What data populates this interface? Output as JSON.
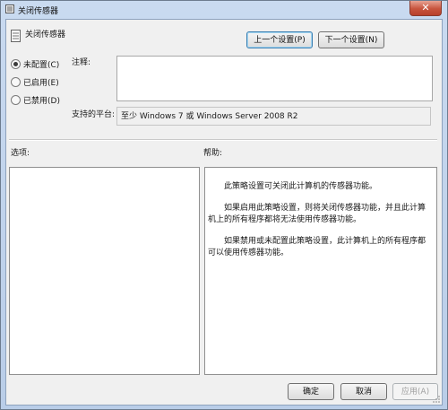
{
  "window": {
    "title": "关闭传感器",
    "close_label": "✕"
  },
  "header": {
    "setting_name": "关闭传感器",
    "prev_button": "上一个设置(P)",
    "next_button": "下一个设置(N)"
  },
  "state": {
    "options": [
      {
        "label": "未配置(C)",
        "checked": true
      },
      {
        "label": "已启用(E)",
        "checked": false
      },
      {
        "label": "已禁用(D)",
        "checked": false
      }
    ]
  },
  "comment": {
    "label": "注释:",
    "value": ""
  },
  "platform": {
    "label": "支持的平台:",
    "value": "至少 Windows 7 或 Windows Server 2008 R2"
  },
  "sections": {
    "options_label": "选项:",
    "help_label": "帮助:"
  },
  "help": {
    "paragraphs": [
      "此策略设置可关闭此计算机的传感器功能。",
      "如果启用此策略设置，则将关闭传感器功能，并且此计算机上的所有程序都将无法使用传感器功能。",
      "如果禁用或未配置此策略设置，此计算机上的所有程序都可以使用传感器功能。"
    ]
  },
  "footer": {
    "ok": "确定",
    "cancel": "取消",
    "apply": "应用(A)"
  }
}
